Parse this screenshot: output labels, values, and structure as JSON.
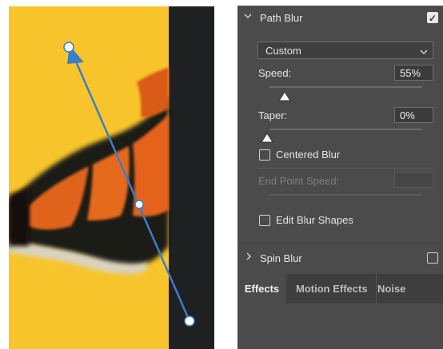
{
  "panel": {
    "path_blur": {
      "title": "Path Blur",
      "enabled": true,
      "preset": "Custom",
      "speed": {
        "label": "Speed:",
        "value": "55%",
        "level": 0.55
      },
      "taper": {
        "label": "Taper:",
        "value": "0%",
        "level": 0.0
      },
      "centered_blur": {
        "label": "Centered Blur",
        "checked": false
      },
      "end_point_speed": {
        "label": "End Point Speed:",
        "value": ""
      },
      "edit_blur_shapes": {
        "label": "Edit Blur Shapes",
        "checked": false
      }
    },
    "spin_blur": {
      "title": "Spin Blur",
      "enabled": false
    },
    "tabs": [
      {
        "label": "Effects",
        "active": true
      },
      {
        "label": "Motion Effects",
        "active": false
      },
      {
        "label": "Noise",
        "active": false
      }
    ]
  },
  "colors": {
    "canvas_background": "#f7c52b",
    "dark_strip": "#1e2022",
    "path_arrow": "#3b7ec9",
    "panel_background": "#4b4b4b"
  },
  "icons": {
    "section_expanded": "chevron-down-icon",
    "section_collapsed": "chevron-right-icon",
    "dropdown": "chevron-down-icon",
    "slider_thumb": "triangle-thumb-icon"
  }
}
